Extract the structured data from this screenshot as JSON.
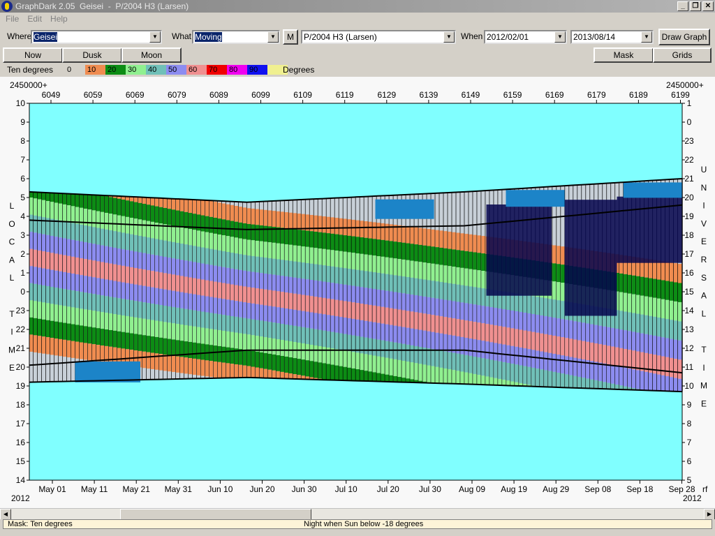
{
  "window": {
    "title": "GraphDark 2.05  Geisei  -  P/2004 H3 (Larsen)"
  },
  "menu": [
    "File",
    "Edit",
    "Help"
  ],
  "toolbar": {
    "where_label": "Where",
    "where_value": "Geisei",
    "what_label": "What",
    "what_value": "Moving",
    "m_label": "M",
    "object_value": "P/2004 H3 (Larsen)",
    "when_label": "When",
    "start_date": "2012/02/01",
    "end_date": "2013/08/14",
    "draw_label": "Draw Graph"
  },
  "buttons": {
    "now": "Now",
    "dusk": "Dusk",
    "moon": "Moon",
    "mask": "Mask",
    "grids": "Grids"
  },
  "legend": {
    "title": "Ten degrees",
    "suffix": "Degrees",
    "items": [
      {
        "label": "0",
        "color": "#d4d0c8"
      },
      {
        "label": "10",
        "color": "#f08c50"
      },
      {
        "label": "20",
        "color": "#0c8c14"
      },
      {
        "label": "30",
        "color": "#90f090"
      },
      {
        "label": "40",
        "color": "#70c0b8"
      },
      {
        "label": "50",
        "color": "#8c8cf0"
      },
      {
        "label": "60",
        "color": "#f09090"
      },
      {
        "label": "70",
        "color": "#f00000"
      },
      {
        "label": "80",
        "color": "#f000f0"
      },
      {
        "label": "90",
        "color": "#1010f0"
      },
      {
        "label": "",
        "color": "#f0f090"
      }
    ]
  },
  "chart_data": {
    "type": "heatmap",
    "jd_prefix": "2450000+",
    "jd_ticks": [
      "6049",
      "6059",
      "6069",
      "6079",
      "6089",
      "6099",
      "6109",
      "6119",
      "6129",
      "6139",
      "6149",
      "6159",
      "6169",
      "6179",
      "6189",
      "6199"
    ],
    "date_ticks": [
      "May 01",
      "May 11",
      "May 21",
      "May 31",
      "Jun 10",
      "Jun 20",
      "Jun 30",
      "Jul 10",
      "Jul 20",
      "Jul 30",
      "Aug 09",
      "Aug 19",
      "Aug 29",
      "Sep 08",
      "Sep 18",
      "Sep 28"
    ],
    "year_left": "2012",
    "year_right": "2012",
    "right_corner_label": "rf",
    "local_time_ticks": [
      "10",
      "9",
      "8",
      "7",
      "6",
      "5",
      "4",
      "3",
      "2",
      "1",
      "0",
      "23",
      "22",
      "21",
      "20",
      "19",
      "18",
      "17",
      "16",
      "15",
      "14"
    ],
    "universal_time_ticks": [
      "1",
      "0",
      "23",
      "22",
      "21",
      "20",
      "19",
      "18",
      "17",
      "16",
      "15",
      "14",
      "13",
      "12",
      "11",
      "10",
      "9",
      "8",
      "7",
      "6",
      "5"
    ],
    "left_axis_letters": [
      "L",
      "O",
      "C",
      "A",
      "L",
      "",
      "T",
      "I",
      "M",
      "E"
    ],
    "right_axis_letters": [
      "U",
      "N",
      "I",
      "V",
      "E",
      "R",
      "S",
      "A",
      "L",
      "",
      "T",
      "I",
      "M",
      "E"
    ],
    "colors": {
      "day": "#80ffff",
      "twilight_blue": "#1c84c8",
      "moon_navy": "#04044c",
      "grey": "#c8d0d8",
      "bands": [
        "#f08c50",
        "#0c8c14",
        "#90f090",
        "#70c0b8",
        "#8c8cf0",
        "#f09090",
        "#8c8cf0",
        "#70c0b8",
        "#90f090",
        "#0c8c14",
        "#f08c50"
      ],
      "grid": "#000000"
    },
    "night_start_hours": [
      19.2,
      19.45,
      19.1,
      18.7
    ],
    "night_end_hours": [
      5.3,
      4.75,
      5.3,
      6.0
    ]
  },
  "status": {
    "mask_text": "Mask:  Ten degrees",
    "night_text": "Night when Sun below -18 degrees"
  }
}
